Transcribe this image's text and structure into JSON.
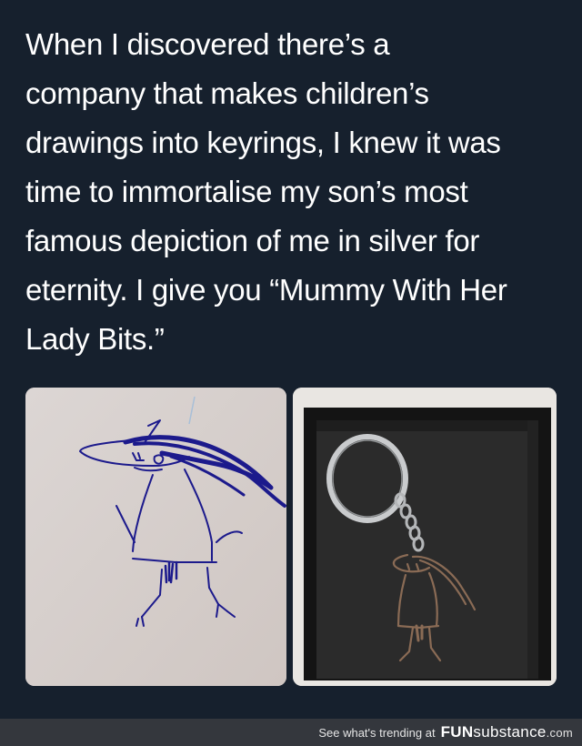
{
  "post": {
    "lines": [
      "When I discovered there’s a",
      "company that makes children’s",
      "drawings into keyrings, I knew it was",
      "time to immortalise my son’s most",
      "famous depiction of me in silver for",
      "eternity. I give you “Mummy With Her",
      "Lady Bits.”"
    ],
    "text_color": "#ffffff",
    "background": "#16202d"
  },
  "images": {
    "left": {
      "subject": "child-drawing",
      "ink_color": "#1c1a8c"
    },
    "right": {
      "subject": "silver-keyring-in-box",
      "metal_color": "#8a6b55"
    }
  },
  "footer": {
    "text": "See what's trending at",
    "brand_bold": "FUN",
    "brand_rest": "substance",
    "brand_suffix": ".com",
    "background": "#34373d"
  }
}
